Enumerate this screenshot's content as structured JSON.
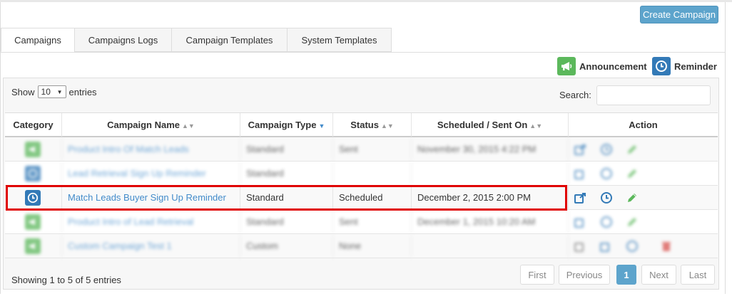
{
  "toolbar": {
    "create_label": "Create Campaign"
  },
  "tabs": [
    {
      "label": "Campaigns"
    },
    {
      "label": "Campaigns Logs"
    },
    {
      "label": "Campaign Templates"
    },
    {
      "label": "System Templates"
    }
  ],
  "legend": {
    "announcement": "Announcement",
    "reminder": "Reminder"
  },
  "controls": {
    "show_label": "Show",
    "page_size": "10",
    "entries_label": "entries",
    "search_label": "Search:",
    "search_value": ""
  },
  "table": {
    "columns": [
      "Category",
      "Campaign Name",
      "Campaign Type",
      "Status",
      "Scheduled / Sent On",
      "Action"
    ],
    "rows": [
      {
        "category": "announcement",
        "name": "Product Intro Of Match Leads",
        "type": "Standard",
        "status": "Sent",
        "scheduled": "November 30, 2015 4:22 PM"
      },
      {
        "category": "reminder",
        "name": "Lead Retrieval Sign Up Reminder",
        "type": "Standard",
        "status": "",
        "scheduled": ""
      },
      {
        "category": "reminder",
        "name": "Match Leads Buyer Sign Up Reminder",
        "type": "Standard",
        "status": "Scheduled",
        "scheduled": "December 2, 2015 2:00 PM"
      },
      {
        "category": "announcement",
        "name": "Product Intro of Lead Retrieval",
        "type": "Standard",
        "status": "Sent",
        "scheduled": "December 1, 2015 10:20 AM"
      },
      {
        "category": "announcement",
        "name": "Custom Campaign Test 1",
        "type": "Custom",
        "status": "None",
        "scheduled": ""
      }
    ]
  },
  "footer": {
    "summary": "Showing 1 to 5 of 5 entries"
  },
  "pagination": {
    "first": "First",
    "previous": "Previous",
    "current": "1",
    "next": "Next",
    "last": "Last"
  },
  "colors": {
    "announcement": "#5cb85c",
    "reminder": "#337ab7",
    "accent": "#5da4cc",
    "highlight": "#e00000"
  },
  "icons": {
    "announcement": "megaphone-icon",
    "reminder": "clock-icon",
    "send": "share-icon",
    "schedule": "clock-icon",
    "edit": "pencil-icon",
    "delete": "trash-icon"
  }
}
